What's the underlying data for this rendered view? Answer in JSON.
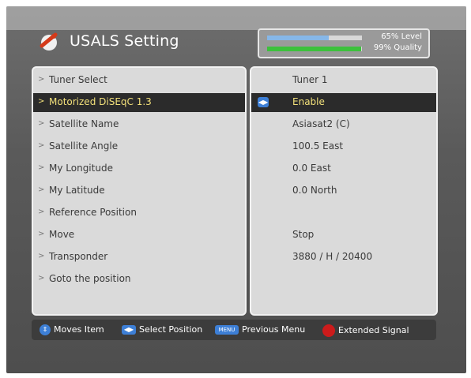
{
  "header": {
    "title": "USALS Setting",
    "icon": "satellite-dish-icon",
    "signal": {
      "level_text": "65% Level",
      "quality_text": "99% Quality",
      "level_fraction": 0.65,
      "quality_fraction": 0.99
    }
  },
  "menu": {
    "items": [
      {
        "label": "Tuner Select",
        "value": "Tuner 1"
      },
      {
        "label": "Motorized DiSEqC 1.3",
        "value": "Enable",
        "selected": true
      },
      {
        "label": "Satellite Name",
        "value": "Asiasat2 (C)"
      },
      {
        "label": "Satellite Angle",
        "value": "100.5 East"
      },
      {
        "label": "My Longitude",
        "value": "0.0 East"
      },
      {
        "label": "My Latitude",
        "value": "0.0 North"
      },
      {
        "label": "Reference Position",
        "value": ""
      },
      {
        "label": "Move",
        "value": "Stop"
      },
      {
        "label": "Transponder",
        "value": "3880 / H / 20400"
      },
      {
        "label": "Goto the position",
        "value": ""
      }
    ]
  },
  "footer": {
    "moves": "Moves Item",
    "select": "Select Position",
    "menu_key": "MENU",
    "previous": "Previous Menu",
    "extended": "Extended Signal"
  },
  "colors": {
    "accent": "#3d7fd6",
    "selected_text": "#f2e07a",
    "red_key": "#cc1b1b"
  }
}
